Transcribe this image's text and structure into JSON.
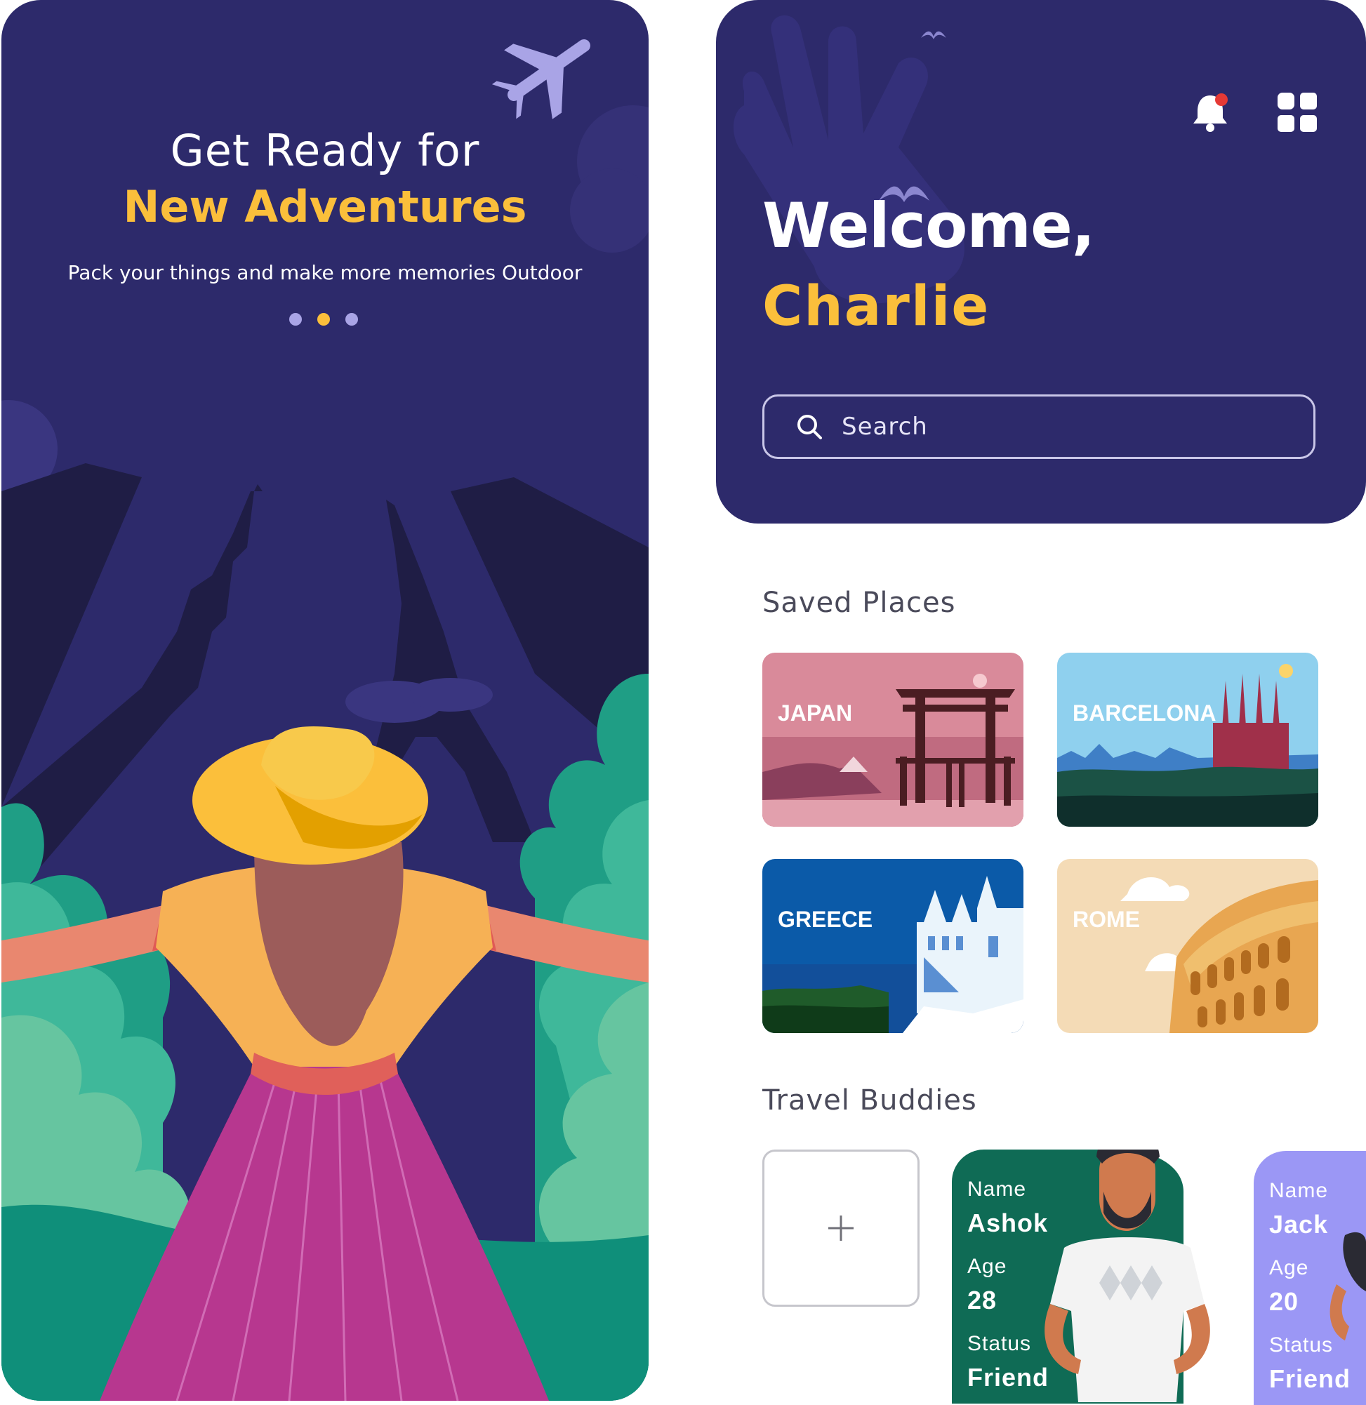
{
  "onboarding": {
    "title_line1": "Get Ready for",
    "title_line2": "New Adventures",
    "subtitle": "Pack your things and make more memories Outdoor",
    "dots": 3,
    "active_dot": 1
  },
  "home": {
    "welcome": "Welcome,",
    "user_name": "Charlie",
    "search_placeholder": "Search",
    "saved_places_title": "Saved Places",
    "places": [
      {
        "label": "JAPAN"
      },
      {
        "label": "BARCELONA"
      },
      {
        "label": "GREECE"
      },
      {
        "label": "ROME"
      }
    ],
    "travel_buddies_title": "Travel Buddies",
    "add_buddy_symbol": "+",
    "buddies": [
      {
        "name_label": "Name",
        "name": "Ashok",
        "age_label": "Age",
        "age": "28",
        "status_label": "Status",
        "status": "Friend"
      },
      {
        "name_label": "Name",
        "name": "Jack",
        "age_label": "Age",
        "age": "20",
        "status_label": "Status",
        "status": "Friend"
      }
    ]
  },
  "colors": {
    "navy": "#2d2a6b",
    "accent_yellow": "#fbbf3b",
    "buddy_green": "#0f6b55",
    "buddy_purple": "#9b97f5",
    "notification_dot": "#e53935"
  },
  "icons": [
    "airplane-icon",
    "bell-icon",
    "grid-menu-icon",
    "search-icon",
    "plus-icon"
  ]
}
